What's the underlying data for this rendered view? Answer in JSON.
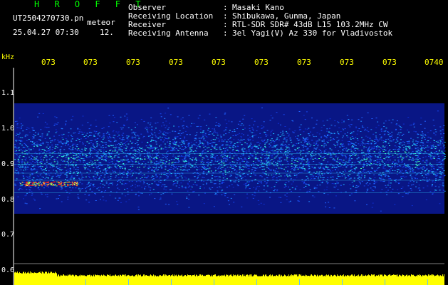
{
  "app": {
    "title": "H R O F F T",
    "filename": "UT2504270730.pn",
    "mode_label": "meteor",
    "datetime": "25.04.27 07:30",
    "count": "12."
  },
  "header": {
    "rows": [
      {
        "label": "Observer",
        "sep": ":",
        "value": "Masaki Kano"
      },
      {
        "label": "Receiving Location",
        "sep": ":",
        "value": "Shibukawa, Gunma, Japan"
      },
      {
        "label": "Receiver",
        "sep": ":",
        "value": "RTL-SDR SDR# 43dB L15 103.2MHz CW"
      },
      {
        "label": "Receiving Antenna",
        "sep": ":",
        "value": "3el Yagi(V) Az 330 for Vladivostok"
      }
    ]
  },
  "axes": {
    "y_unit": "kHz",
    "y_ticks": [
      "1.1",
      "1.0",
      "0.9",
      "0.8",
      "0.7",
      "0.6"
    ],
    "x_ticks": [
      "073",
      "073",
      "073",
      "073",
      "073",
      "073",
      "073",
      "073",
      "073",
      "0740"
    ]
  },
  "colors": {
    "background": "#000000",
    "title": "#00ff00",
    "tick_labels": "#ffff00",
    "noise_band": "#2040ff",
    "signal_hot": "#ff2020",
    "power_bar": "#ffff00",
    "grid": "#808080"
  },
  "spectrogram": {
    "band_center_khz": 0.9,
    "band_low_khz": 0.78,
    "band_high_khz": 1.05,
    "hot_signal_khz": 0.845
  }
}
